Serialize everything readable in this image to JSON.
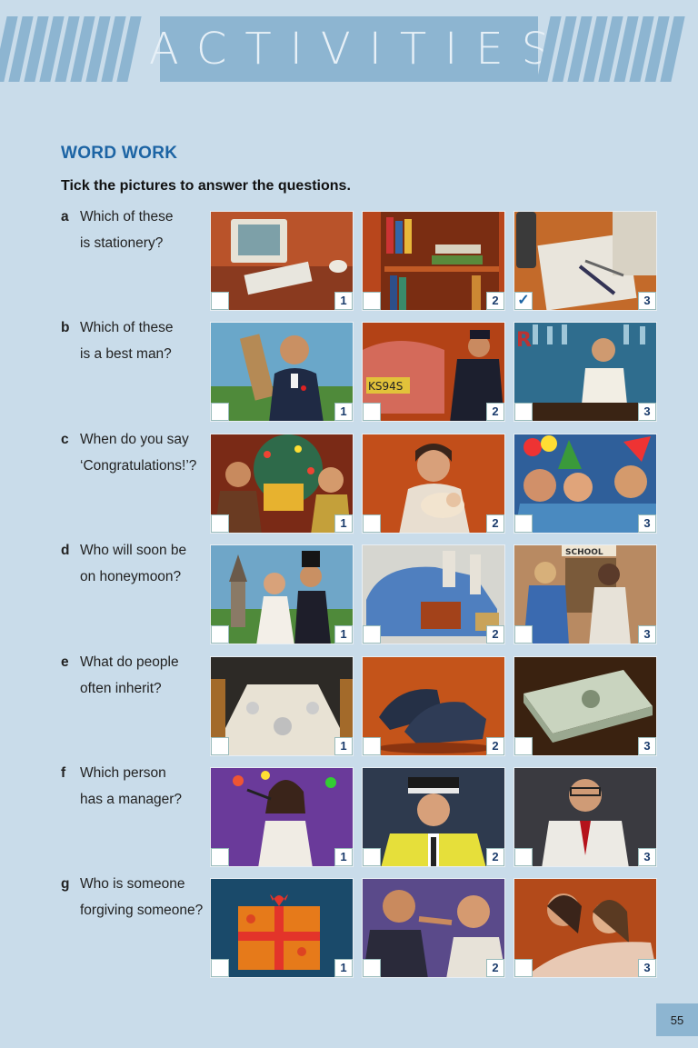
{
  "header": {
    "title": "ACTIVITIES"
  },
  "section_title": "WORD WORK",
  "instruction": "Tick the pictures to answer the questions.",
  "questions": [
    {
      "letter": "a",
      "line1": "Which of these",
      "line2": "is stationery?",
      "ticked": "3",
      "pictures": [
        {
          "num": "1",
          "subject": "computer-monitor-keyboard"
        },
        {
          "num": "2",
          "subject": "bookshelf"
        },
        {
          "num": "3",
          "subject": "pens-and-paper"
        }
      ]
    },
    {
      "letter": "b",
      "line1": "Which of these",
      "line2": "is a best man?",
      "pictures": [
        {
          "num": "1",
          "subject": "man-in-suit"
        },
        {
          "num": "2",
          "subject": "policeman-car"
        },
        {
          "num": "3",
          "subject": "barman"
        }
      ]
    },
    {
      "letter": "c",
      "line1": "When do you say",
      "line2": "‘Congratulations!’?",
      "pictures": [
        {
          "num": "1",
          "subject": "christmas-gift"
        },
        {
          "num": "2",
          "subject": "mother-baby"
        },
        {
          "num": "3",
          "subject": "party"
        }
      ]
    },
    {
      "letter": "d",
      "line1": "Who will soon be",
      "line2": "on honeymoon?",
      "pictures": [
        {
          "num": "1",
          "subject": "wedding-couple"
        },
        {
          "num": "2",
          "subject": "car-luggage"
        },
        {
          "num": "3",
          "subject": "school-children"
        }
      ]
    },
    {
      "letter": "e",
      "line1": "What do people",
      "line2": "often inherit?",
      "pictures": [
        {
          "num": "1",
          "subject": "dining-table"
        },
        {
          "num": "2",
          "subject": "shoes"
        },
        {
          "num": "3",
          "subject": "money"
        }
      ]
    },
    {
      "letter": "f",
      "line1": "Which person",
      "line2": "has a manager?",
      "pictures": [
        {
          "num": "1",
          "subject": "singer"
        },
        {
          "num": "2",
          "subject": "police-officer"
        },
        {
          "num": "3",
          "subject": "doctor"
        }
      ]
    },
    {
      "letter": "g",
      "line1": "Who is someone",
      "line2": "forgiving someone?",
      "pictures": [
        {
          "num": "1",
          "subject": "present"
        },
        {
          "num": "2",
          "subject": "argument"
        },
        {
          "num": "3",
          "subject": "hug"
        }
      ]
    }
  ],
  "tick_mark": "✓",
  "page_number": "55"
}
